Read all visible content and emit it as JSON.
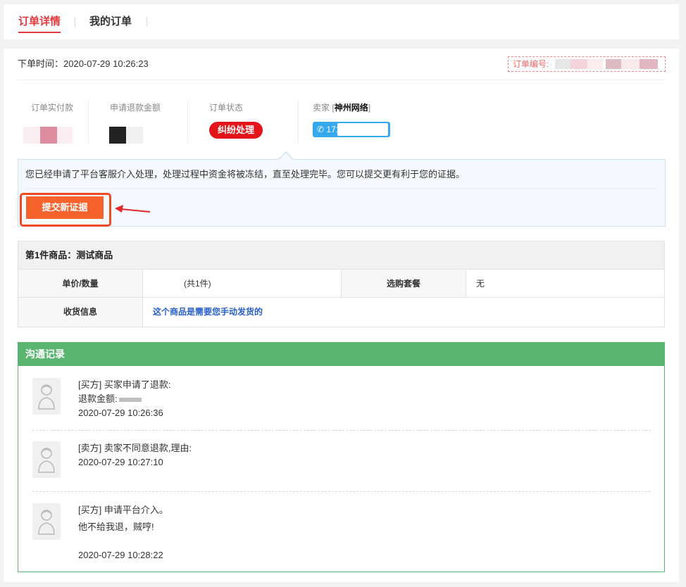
{
  "tabs": [
    {
      "label": "订单详情",
      "active": true
    },
    {
      "label": "我的订单",
      "active": false
    }
  ],
  "order": {
    "time_label": "下单时间：",
    "time_value": "2020-07-29 10:26:23",
    "number_label": "订单编号:"
  },
  "summary": {
    "paid_label": "订单实付款",
    "refund_label": "申请退款金额",
    "status_label": "订单状态",
    "status_value": "纠纷处理",
    "seller_label": "卖家",
    "seller_name": "神州网络",
    "phone_prefix": "171"
  },
  "notice": {
    "text": "您已经申请了平台客服介入处理，处理过程中资金将被冻结，直至处理完毕。您可以提交更有利于您的证据。",
    "button": "提交新证据"
  },
  "product": {
    "title": "第1件商品：测试商品",
    "price_qty_label": "单价/数量",
    "price_qty_value": "(共1件)",
    "package_label": "选购套餐",
    "package_value": "无",
    "shipping_label": "收货信息",
    "shipping_value": "这个商品是需要您手动发货的"
  },
  "communication": {
    "title": "沟通记录",
    "entries": [
      {
        "line1": "[买方] 买家申请了退款:",
        "line2": "退款金额:",
        "time": "2020-07-29 10:26:36"
      },
      {
        "line1": "[卖方] 卖家不同意退款,理由:",
        "time": "2020-07-29 10:27:10"
      },
      {
        "line1": "[买方] 申请平台介入。",
        "line2": "他不给我退，贼哼!",
        "time": "2020-07-29 10:28:22"
      }
    ]
  },
  "colors": {
    "accent": "#e4393c",
    "status_red": "#e3141a",
    "button_orange": "#f5622c",
    "phone_blue": "#35a8ee",
    "comm_green": "#5ab56f",
    "link_blue": "#2a60c8"
  }
}
